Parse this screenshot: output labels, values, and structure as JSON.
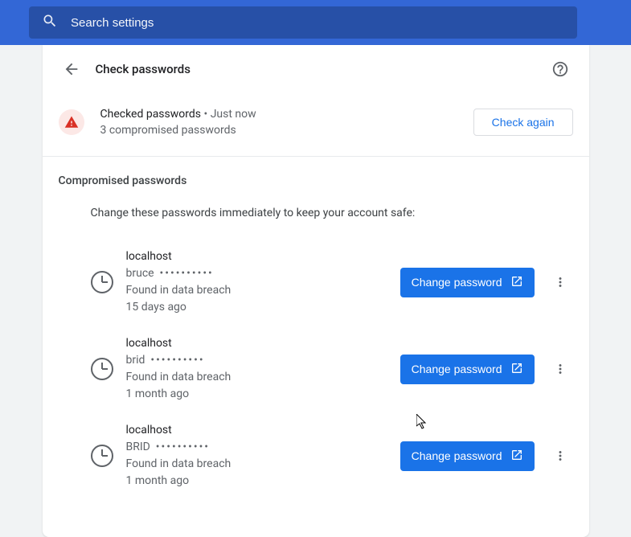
{
  "search": {
    "placeholder": "Search settings"
  },
  "page": {
    "title": "Check passwords"
  },
  "status": {
    "heading": "Checked passwords",
    "separator": "•",
    "time": "Just now",
    "summary": "3 compromised passwords",
    "check_again_label": "Check again"
  },
  "section": {
    "title": "Compromised passwords",
    "subtitle": "Change these passwords immediately to keep your account safe:"
  },
  "change_label": "Change password",
  "entries": [
    {
      "site": "localhost",
      "username": "bruce",
      "dots": "••••••••••",
      "breach": "Found in data breach",
      "age": "15 days ago"
    },
    {
      "site": "localhost",
      "username": "brid",
      "dots": "••••••••••",
      "breach": "Found in data breach",
      "age": "1 month ago"
    },
    {
      "site": "localhost",
      "username": "BRID",
      "dots": "••••••••••",
      "breach": "Found in data breach",
      "age": "1 month ago"
    }
  ]
}
